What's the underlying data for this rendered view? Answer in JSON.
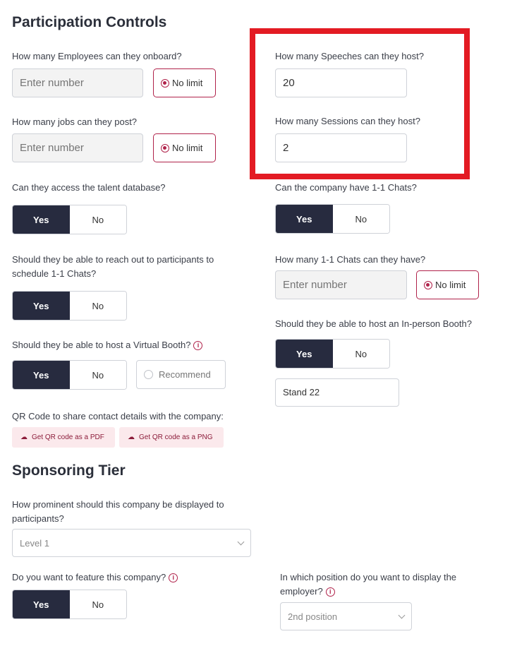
{
  "participation": {
    "title": "Participation Controls",
    "employees_question": "How many Employees can they onboard?",
    "employees_placeholder": "Enter number",
    "employees_nolimit": "No limit",
    "jobs_question": "How many jobs can they post?",
    "jobs_placeholder": "Enter number",
    "jobs_nolimit": "No limit",
    "speeches_question": "How many Speeches can they host?",
    "speeches_value": "20",
    "sessions_question": "How many Sessions can they host?",
    "sessions_value": "2",
    "talent_question": "Can they access the talent database?",
    "chats_company_question": "Can the company have 1-1 Chats?",
    "reach_question_line1": "Should they be able to reach out to participants to",
    "reach_question_line2": "schedule 1-1 Chats?",
    "chats_count_question": "How many 1-1 Chats can they have?",
    "chats_placeholder": "Enter number",
    "chats_nolimit": "No limit",
    "inperson_question": "Should they be able to host an In-person Booth?",
    "virtual_question": "Should they be able to host a Virtual Booth?",
    "recommend_label": "Recommend",
    "stand_value": "Stand 22",
    "qr_question": "QR Code to share contact details with the company:",
    "qr_pdf": "Get QR code as a PDF",
    "qr_png": "Get QR code as a PNG",
    "yes": "Yes",
    "no": "No"
  },
  "sponsoring": {
    "title": "Sponsoring Tier",
    "prominence_line1": "How prominent should this company be displayed to",
    "prominence_line2": "participants?",
    "prominence_value": "Level 1",
    "feature_question": "Do you want to feature this company?",
    "position_line1": "In which position do you want to display the",
    "position_line2": "employer?",
    "position_value": "2nd position",
    "yes": "Yes",
    "no": "No"
  },
  "colors": {
    "accent": "#b0224a",
    "toggle_selected": "#272b3f",
    "highlight_box": "#e31b23"
  }
}
